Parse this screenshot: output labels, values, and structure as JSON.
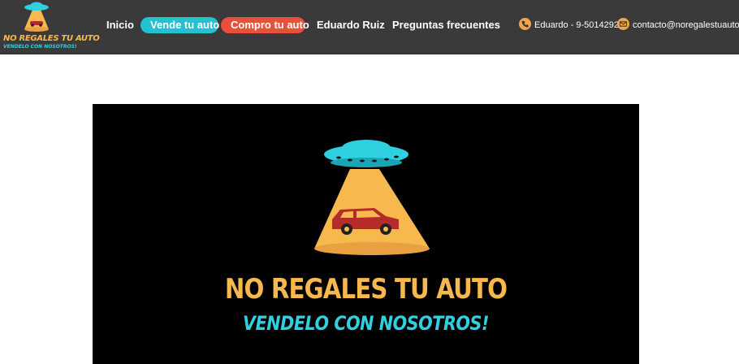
{
  "logo": {
    "title": "NO REGALES TU AUTO",
    "subtitle": "VENDELO CON NOSOTROS!"
  },
  "nav": {
    "items": [
      {
        "label": "Inicio"
      },
      {
        "label": "Vende tu auto"
      },
      {
        "label": "Compro tu auto"
      },
      {
        "label": "Eduardo Ruiz"
      },
      {
        "label": "Preguntas frecuentes"
      }
    ]
  },
  "contact": {
    "phone": "Eduardo - 9-50142920",
    "email": "contacto@noregalestuauto.cl",
    "phone_icon": "phone-icon",
    "email_icon": "envelope-icon"
  },
  "hero": {
    "title": "NO REGALES TU AUTO",
    "subtitle": "VENDELO CON NOSOTROS!"
  },
  "colors": {
    "navbar": "#3a3a3a",
    "accent_teal": "#22c2d1",
    "accent_red": "#e8503a",
    "brand_orange": "#f7b84e",
    "brand_cyan": "#2fd0e0"
  }
}
